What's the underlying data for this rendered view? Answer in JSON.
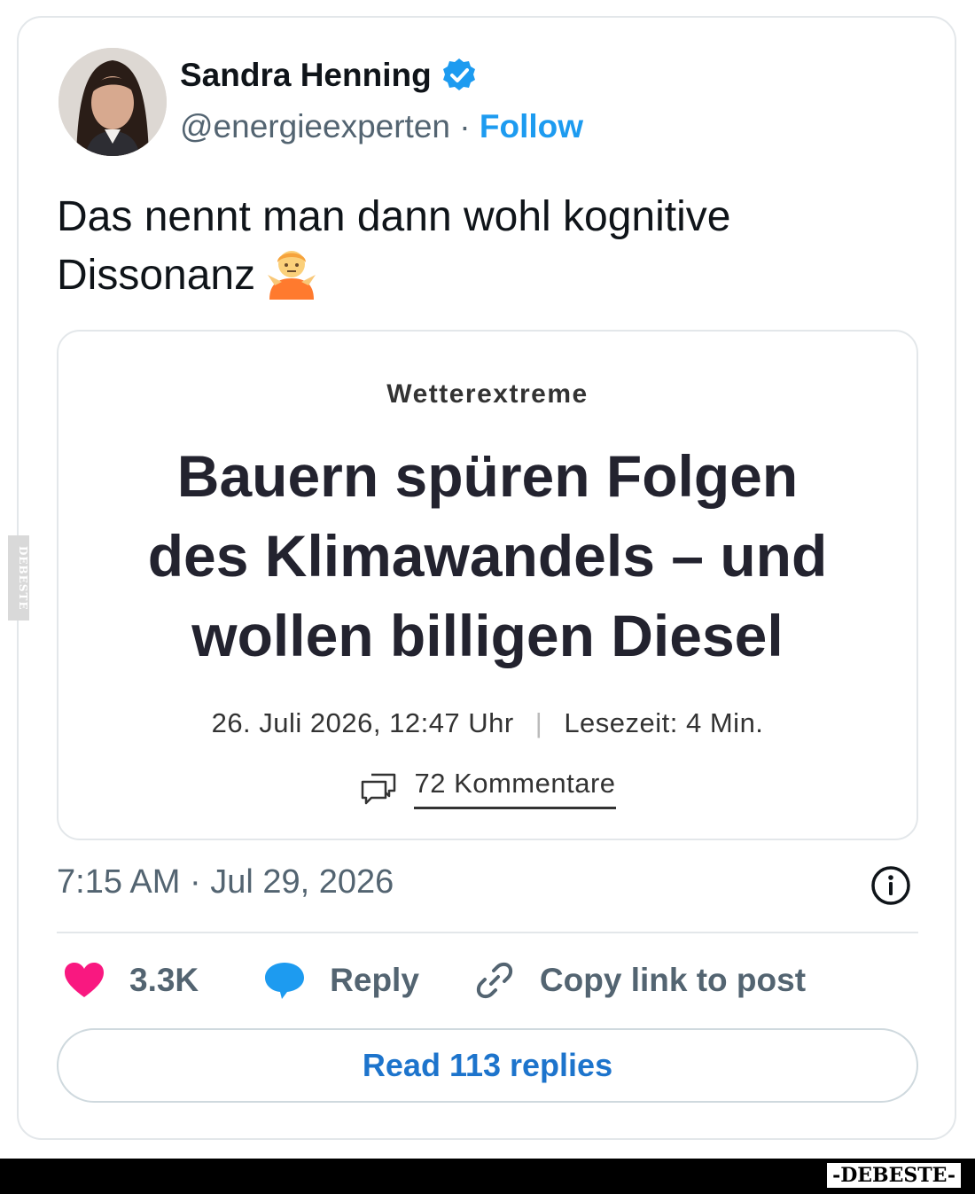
{
  "author": {
    "name": "Sandra Henning",
    "handle": "@energieexperten",
    "separator": "·",
    "follow_label": "Follow",
    "verified_icon": "verified-badge-icon",
    "accent": "#1d9bf0"
  },
  "tweet": {
    "text": "Das nennt man dann wohl kognitive Dissonanz",
    "emoji": "shrug-emoji"
  },
  "article": {
    "kicker": "Wetterextreme",
    "headline_lines": [
      "Bauern spüren Folgen",
      "des Klimawandels – und",
      "wollen billigen Diesel"
    ],
    "date": "26. Juli 2026, 12:47 Uhr",
    "meta_sep": "|",
    "reading_time": "Lesezeit: 4 Min.",
    "comments": "72 Kommentare"
  },
  "timestamp": "7:15 AM · Jul 29, 2026",
  "actions": {
    "likes": "3.3K",
    "reply": "Reply",
    "copy_link": "Copy link to post",
    "like_color": "#f91880",
    "reply_color": "#1d9bf0"
  },
  "read_replies": "Read 113 replies",
  "watermark": {
    "side": "DEBESTE",
    "footer": "-DEBESTE-"
  }
}
